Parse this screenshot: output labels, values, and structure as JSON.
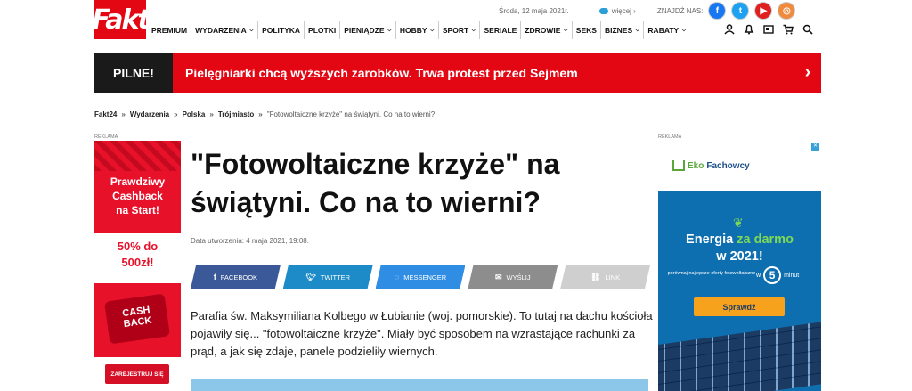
{
  "header": {
    "logo": "Fakt",
    "date": "Środa, 12 maja 2021r.",
    "weather_more": "więcej ›",
    "find_us": "ZNAJDŹ NAS:",
    "social": [
      "f",
      "t",
      "▶",
      "◎"
    ],
    "nav": [
      {
        "label": "PREMIUM",
        "dropdown": false
      },
      {
        "label": "WYDARZENIA",
        "dropdown": true
      },
      {
        "label": "POLITYKA",
        "dropdown": false
      },
      {
        "label": "PLOTKI",
        "dropdown": false
      },
      {
        "label": "PIENIĄDZE",
        "dropdown": true
      },
      {
        "label": "HOBBY",
        "dropdown": true
      },
      {
        "label": "SPORT",
        "dropdown": true
      },
      {
        "label": "SERIALE",
        "dropdown": false
      },
      {
        "label": "ZDROWIE",
        "dropdown": true
      },
      {
        "label": "SEKS",
        "dropdown": false
      },
      {
        "label": "BIZNES",
        "dropdown": true
      },
      {
        "label": "RABATY",
        "dropdown": true
      }
    ],
    "icons": [
      "user-icon",
      "notification-icon",
      "newspaper-icon",
      "cart-icon",
      "search-icon"
    ]
  },
  "breaking": {
    "tag": "PILNE!",
    "headline": "Pielęgniarki chcą wyższych zarobków. Trwa protest przed Sejmem",
    "arrow": "›"
  },
  "breadcrumb": [
    "Fakt24",
    "Wydarzenia",
    "Polska",
    "Trójmiasto",
    "\"Fotowoltaiczne krzyże\" na świątyni. Co na to wierni?"
  ],
  "breadcrumb_sep": "»",
  "ad_label": "REKLAMA",
  "left_ad": {
    "line1": "Prawdziwy",
    "line2": "Cashback",
    "line3": "na Start!",
    "offer1": "50% do",
    "offer2": "500zł!",
    "badge1": "CASH",
    "badge2": "BACK",
    "register": "ZAREJESTRUJ SIĘ"
  },
  "article": {
    "title": "\"Fotowoltaiczne krzyże\" na świątyni. Co na to wierni?",
    "created": "Data utworzenia: 4 maja 2021, 19:08.",
    "share": [
      "FACEBOOK",
      "TWITTER",
      "MESSENGER",
      "WYŚLIJ",
      "LINK"
    ],
    "lead": "Parafia św. Maksymiliana Kolbego w Łubianie (woj. pomorskie). To tutaj na dachu kościoła pojawiły się... \"fotowoltaiczne krzyże\". Miały być sposobem na wzrastające rachunki za prąd, a jak się zdaje, panele podzieliły wiernych."
  },
  "right_ad": {
    "brand_eko": "Eko",
    "brand_rest": "Fachowcy",
    "head1": "Energia",
    "head_green": "za darmo",
    "head2": "w 2021!",
    "sub": "porównaj najlepsze oferty fotowoltaiczne",
    "timer_pre": "w",
    "timer_num": "5",
    "timer_post": "minut",
    "cta": "Sprawdź"
  }
}
